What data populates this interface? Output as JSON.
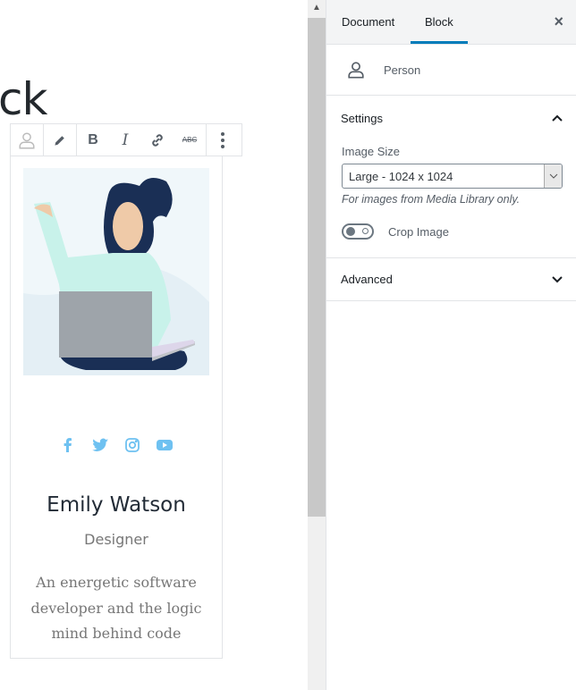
{
  "editor": {
    "heading_fragment": "ck",
    "toolbar": {
      "items": [
        "person-block-icon",
        "pencil-icon",
        "bold-icon",
        "italic-icon",
        "link-icon",
        "strikethrough-icon",
        "more-options-icon"
      ]
    },
    "person": {
      "name": "Emily Watson",
      "role": "Designer",
      "bio_lines": [
        "An energetic software",
        "developer and the logic",
        "mind behind code"
      ],
      "social": [
        "facebook-icon",
        "twitter-icon",
        "instagram-icon",
        "youtube-icon"
      ],
      "social_color": "#6ec1f1"
    }
  },
  "sidebar": {
    "tabs": [
      {
        "label": "Document",
        "active": false
      },
      {
        "label": "Block",
        "active": true
      }
    ],
    "close": "×",
    "block_name": "Person",
    "settings": {
      "title": "Settings",
      "expanded": true,
      "image_size_label": "Image Size",
      "image_size_value": "Large - 1024 x 1024",
      "help": "For images from Media Library only.",
      "crop_label": "Crop Image",
      "crop_enabled": false
    },
    "advanced": {
      "title": "Advanced",
      "expanded": false
    },
    "accent": "#007cba"
  }
}
